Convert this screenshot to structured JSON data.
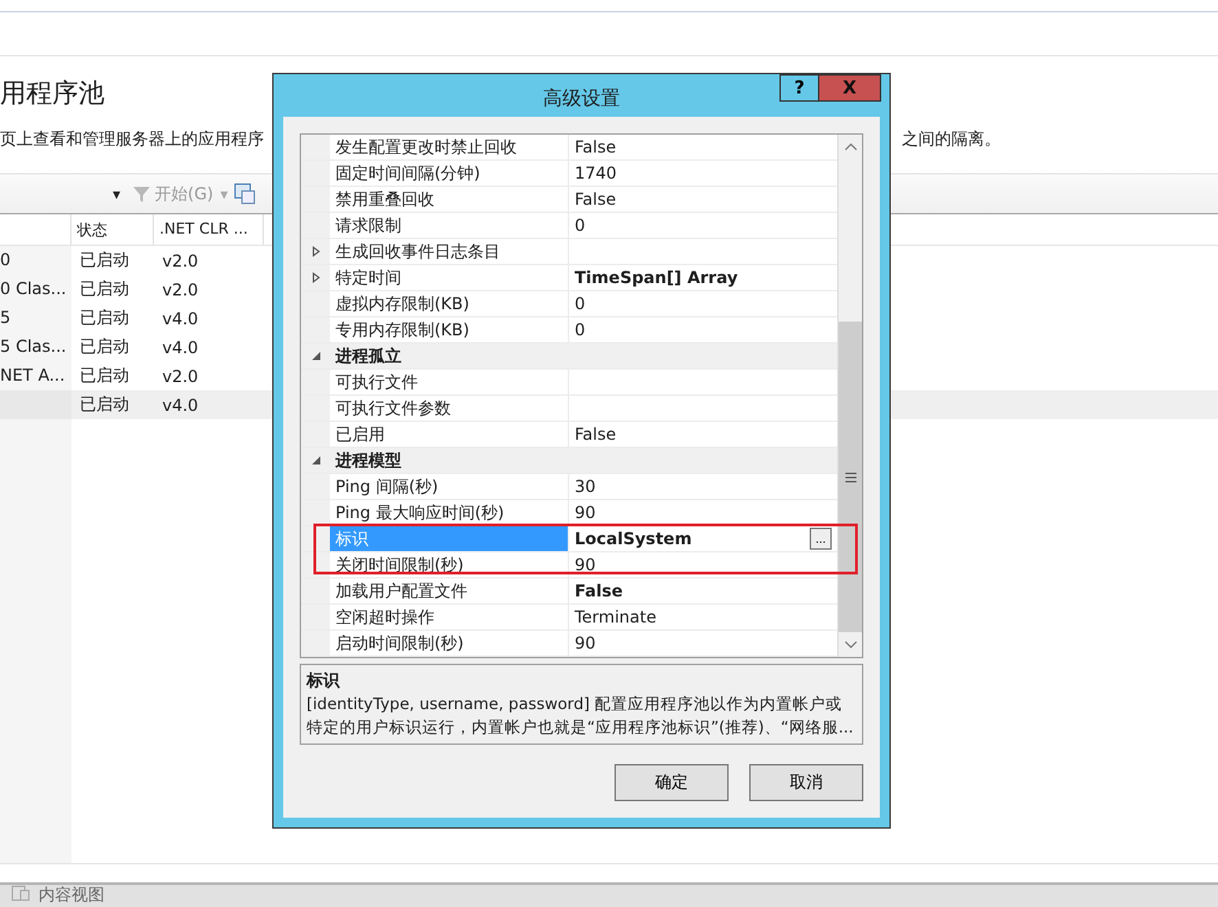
{
  "page": {
    "title": "用程序池",
    "description_left": "页上查看和管理服务器上的应用程序",
    "description_right": "之间的隔离。"
  },
  "toolbar": {
    "caret": "▾",
    "start_label": "开始(G)",
    "start_caret": "▾"
  },
  "table": {
    "columns": [
      "状态",
      ".NET CLR ..."
    ],
    "rows": [
      {
        "column_1": "0",
        "status": "已启动",
        "clr": "v2.0",
        "selected": false
      },
      {
        "column_1": "0 Clas...",
        "status": "已启动",
        "clr": "v2.0",
        "selected": false
      },
      {
        "column_1": "5",
        "status": "已启动",
        "clr": "v4.0",
        "selected": false
      },
      {
        "column_1": "5 Clas...",
        "status": "已启动",
        "clr": "v4.0",
        "selected": false
      },
      {
        "column_1": "NET A...",
        "status": "已启动",
        "clr": "v2.0",
        "selected": false
      },
      {
        "status": "已启动",
        "clr": "v4.0",
        "selected": true
      }
    ]
  },
  "dialog": {
    "title": "高级设置",
    "help": "?",
    "close": "X",
    "properties": [
      {
        "kind": "property",
        "name": "发生配置更改时禁止回收",
        "value": "False",
        "bold": false,
        "selected": false
      },
      {
        "kind": "property",
        "name": "固定时间间隔(分钟)",
        "value": "1740",
        "bold": false,
        "selected": false
      },
      {
        "kind": "property",
        "name": "禁用重叠回收",
        "value": "False",
        "bold": false,
        "selected": false
      },
      {
        "kind": "property",
        "name": "请求限制",
        "value": "0",
        "bold": false,
        "selected": false
      },
      {
        "kind": "group",
        "name": "生成回收事件日志条目",
        "expanded": false,
        "selected": false
      },
      {
        "kind": "group",
        "name": "特定时间",
        "value": "TimeSpan[] Array",
        "expanded": false,
        "bold": true,
        "selected": false
      },
      {
        "kind": "property",
        "name": "虚拟内存限制(KB)",
        "value": "0",
        "bold": false,
        "selected": false
      },
      {
        "kind": "property",
        "name": "专用内存限制(KB)",
        "value": "0",
        "bold": false,
        "selected": false
      },
      {
        "kind": "category",
        "name": "进程孤立",
        "expanded": true
      },
      {
        "kind": "property",
        "name": "可执行文件",
        "selected": false
      },
      {
        "kind": "property",
        "name": "可执行文件参数",
        "selected": false
      },
      {
        "kind": "property",
        "name": "已启用",
        "value": "False",
        "bold": false,
        "selected": false
      },
      {
        "kind": "category",
        "name": "进程模型",
        "expanded": true
      },
      {
        "kind": "property",
        "name": "Ping 间隔(秒)",
        "value": "30",
        "bold": false,
        "selected": false
      },
      {
        "kind": "property",
        "name": "Ping 最大响应时间(秒)",
        "value": "90",
        "bold": false,
        "selected": false
      },
      {
        "kind": "property",
        "name": "标识",
        "value": "LocalSystem",
        "bold": true,
        "selected": true,
        "edit_button": "..."
      },
      {
        "kind": "property",
        "name": "关闭时间限制(秒)",
        "value": "90",
        "bold": false,
        "selected": false
      },
      {
        "kind": "property",
        "name": "加载用户配置文件",
        "value": "False",
        "bold": true,
        "selected": false
      },
      {
        "kind": "property",
        "name": "空闲超时操作",
        "value": "Terminate",
        "bold": false,
        "selected": false
      },
      {
        "kind": "property",
        "name": "启动时间限制(秒)",
        "value": "90",
        "bold": false,
        "selected": false
      }
    ],
    "description": {
      "title": "标识",
      "text": "[identityType, username, password] 配置应用程序池以作为内置帐户或特定的用户标识运行，内置帐户也就是“应用程序池标识”(推荐)、“网络服..."
    },
    "buttons": [
      "确定",
      "取消"
    ]
  },
  "status_bar": {
    "label": "内容视图"
  }
}
